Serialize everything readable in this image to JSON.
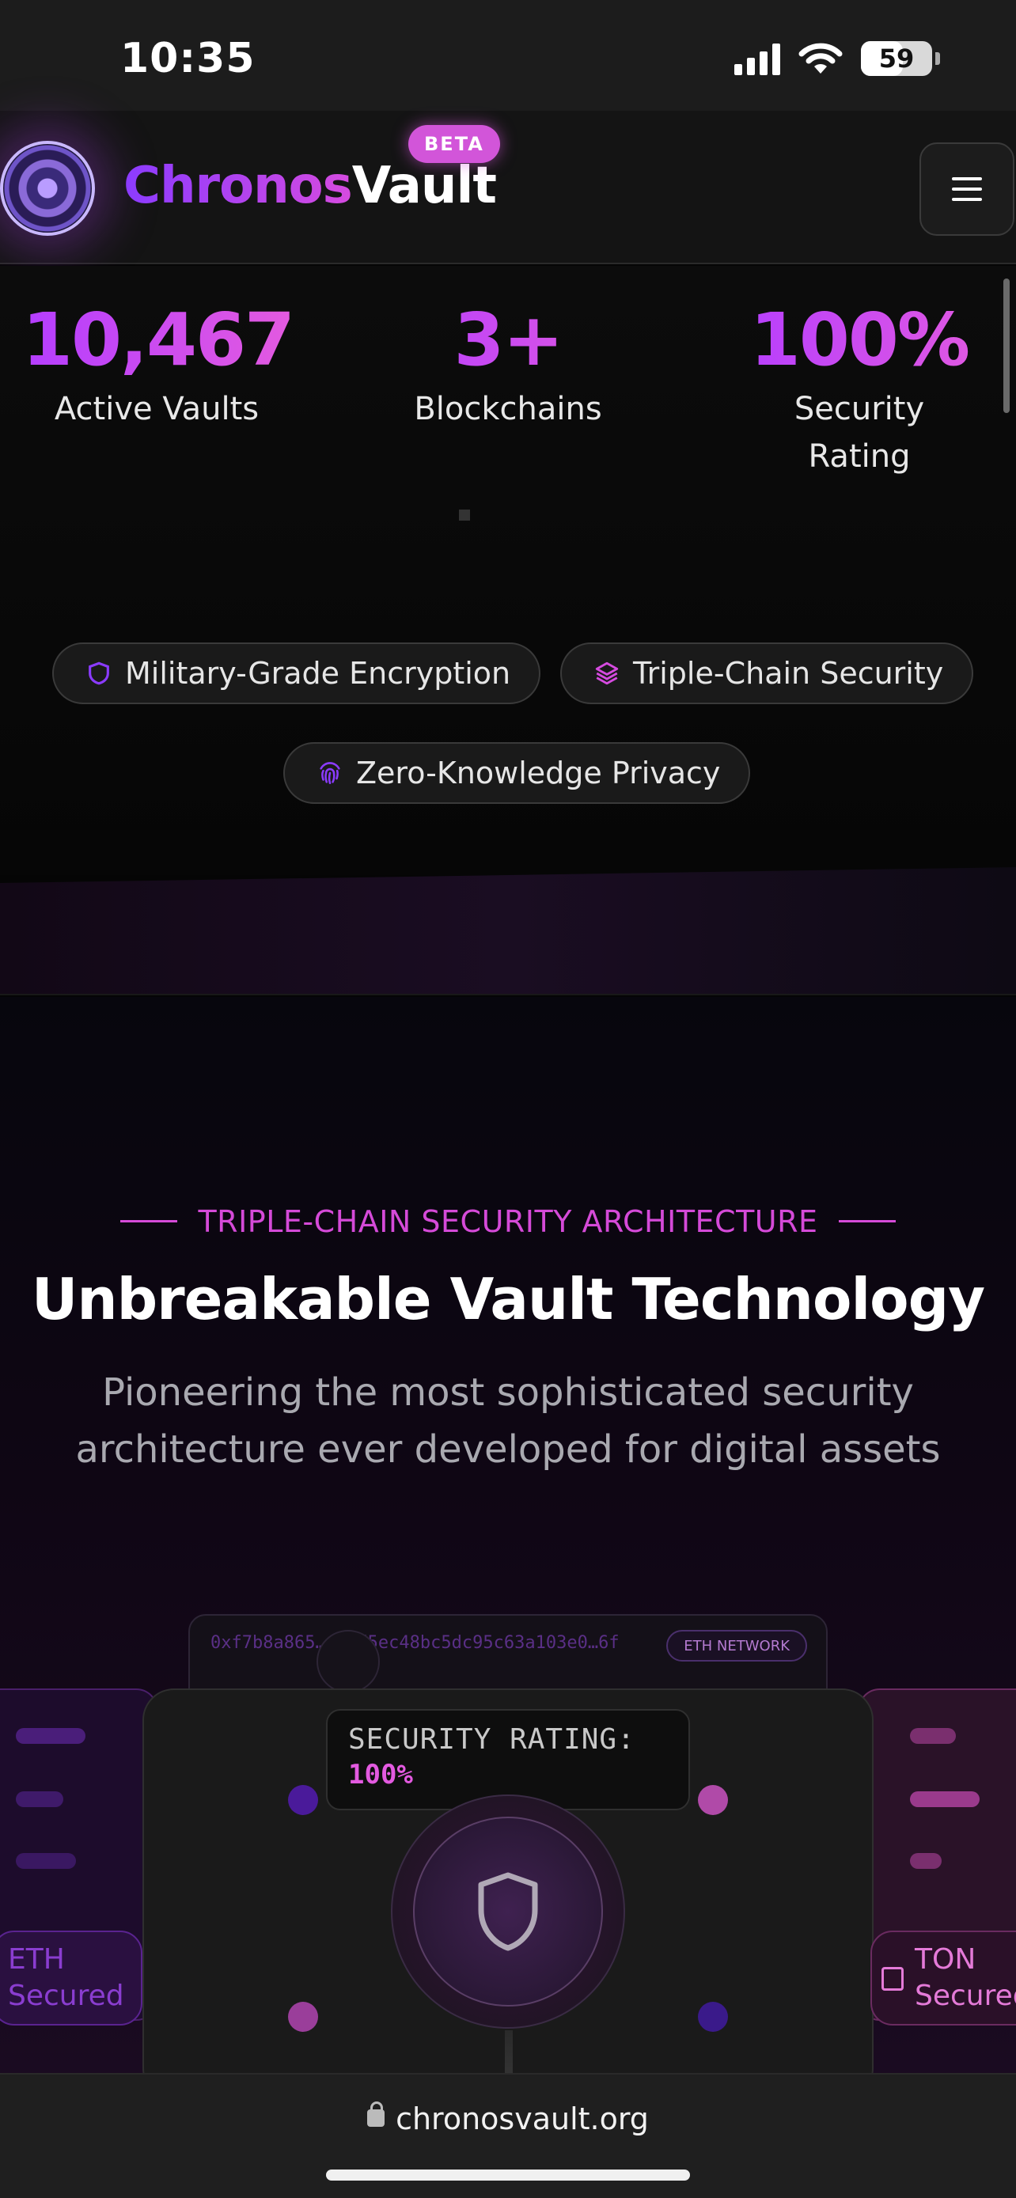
{
  "status_bar": {
    "time": "10:35",
    "battery": "59",
    "battery_level": 0.59
  },
  "header": {
    "brand_primary": "Chronos",
    "brand_secondary": "Vault",
    "badge": "BETA",
    "menu_icon": "hamburger-icon"
  },
  "stats": [
    {
      "value": "10,467",
      "label": "Active Vaults"
    },
    {
      "value": "3+",
      "label": "Blockchains"
    },
    {
      "value": "100%",
      "label_line1": "Security",
      "label_line2": "Rating"
    }
  ],
  "features": [
    {
      "label": "Military-Grade Encryption",
      "icon": "shield-icon"
    },
    {
      "label": "Triple-Chain Security",
      "icon": "layers-icon"
    },
    {
      "label": "Zero-Knowledge Privacy",
      "icon": "fingerprint-icon"
    }
  ],
  "architecture": {
    "eyebrow": "TRIPLE-CHAIN SECURITY ARCHITECTURE",
    "headline": "Unbreakable Vault Technology",
    "subhead": "Pioneering the most sophisticated security architecture ever developed for digital assets"
  },
  "visual": {
    "hash": "0xf7b8a865…d9bd5ec48bc5dc95c63a103e0…6f",
    "network_label": "ETH NETWORK",
    "rating_label": "SECURITY RATING:",
    "rating_value": "100%",
    "eth_badge_line1": "ETH",
    "eth_badge_line2": "Secured",
    "ton_badge_line1": "TON",
    "ton_badge_line2": "Secured"
  },
  "browser": {
    "url": "chronosvault.org"
  },
  "colors": {
    "accent_purple": "#8b3bff",
    "accent_pink": "#d64be0",
    "background": "#050505"
  }
}
